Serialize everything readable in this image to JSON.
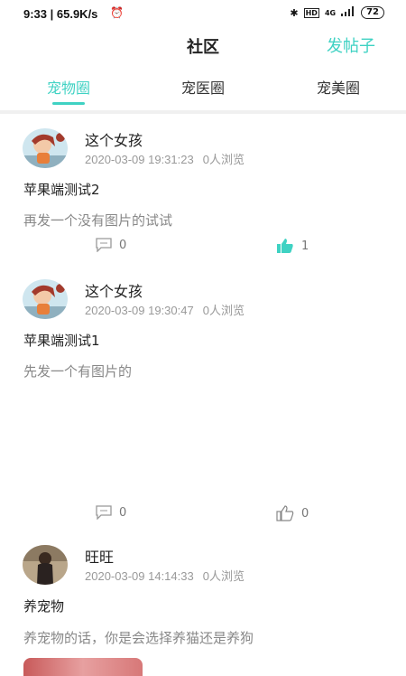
{
  "status_bar": {
    "time": "9:33 | 65.9K/s",
    "network": "4G",
    "battery": "72"
  },
  "header": {
    "title": "社区",
    "post_button": "发帖子"
  },
  "tabs": [
    {
      "label": "宠物圈",
      "active": true
    },
    {
      "label": "宠医圈",
      "active": false
    },
    {
      "label": "宠美圈",
      "active": false
    }
  ],
  "colors": {
    "accent": "#3fd2c3",
    "muted_text": "#888888"
  },
  "posts": [
    {
      "author": "这个女孩",
      "time": "2020-03-09 19:31:23",
      "views": "0人浏览",
      "title": "苹果端测试2",
      "body": "再发一个没有图片的试试",
      "comments": "0",
      "likes": "1",
      "liked": true
    },
    {
      "author": "这个女孩",
      "time": "2020-03-09 19:30:47",
      "views": "0人浏览",
      "title": "苹果端测试1",
      "body": "先发一个有图片的",
      "comments": "0",
      "likes": "0",
      "liked": false
    },
    {
      "author": "旺旺",
      "time": "2020-03-09 14:14:33",
      "views": "0人浏览",
      "title": "养宠物",
      "body": "养宠物的话，你是会选择养猫还是养狗"
    }
  ]
}
